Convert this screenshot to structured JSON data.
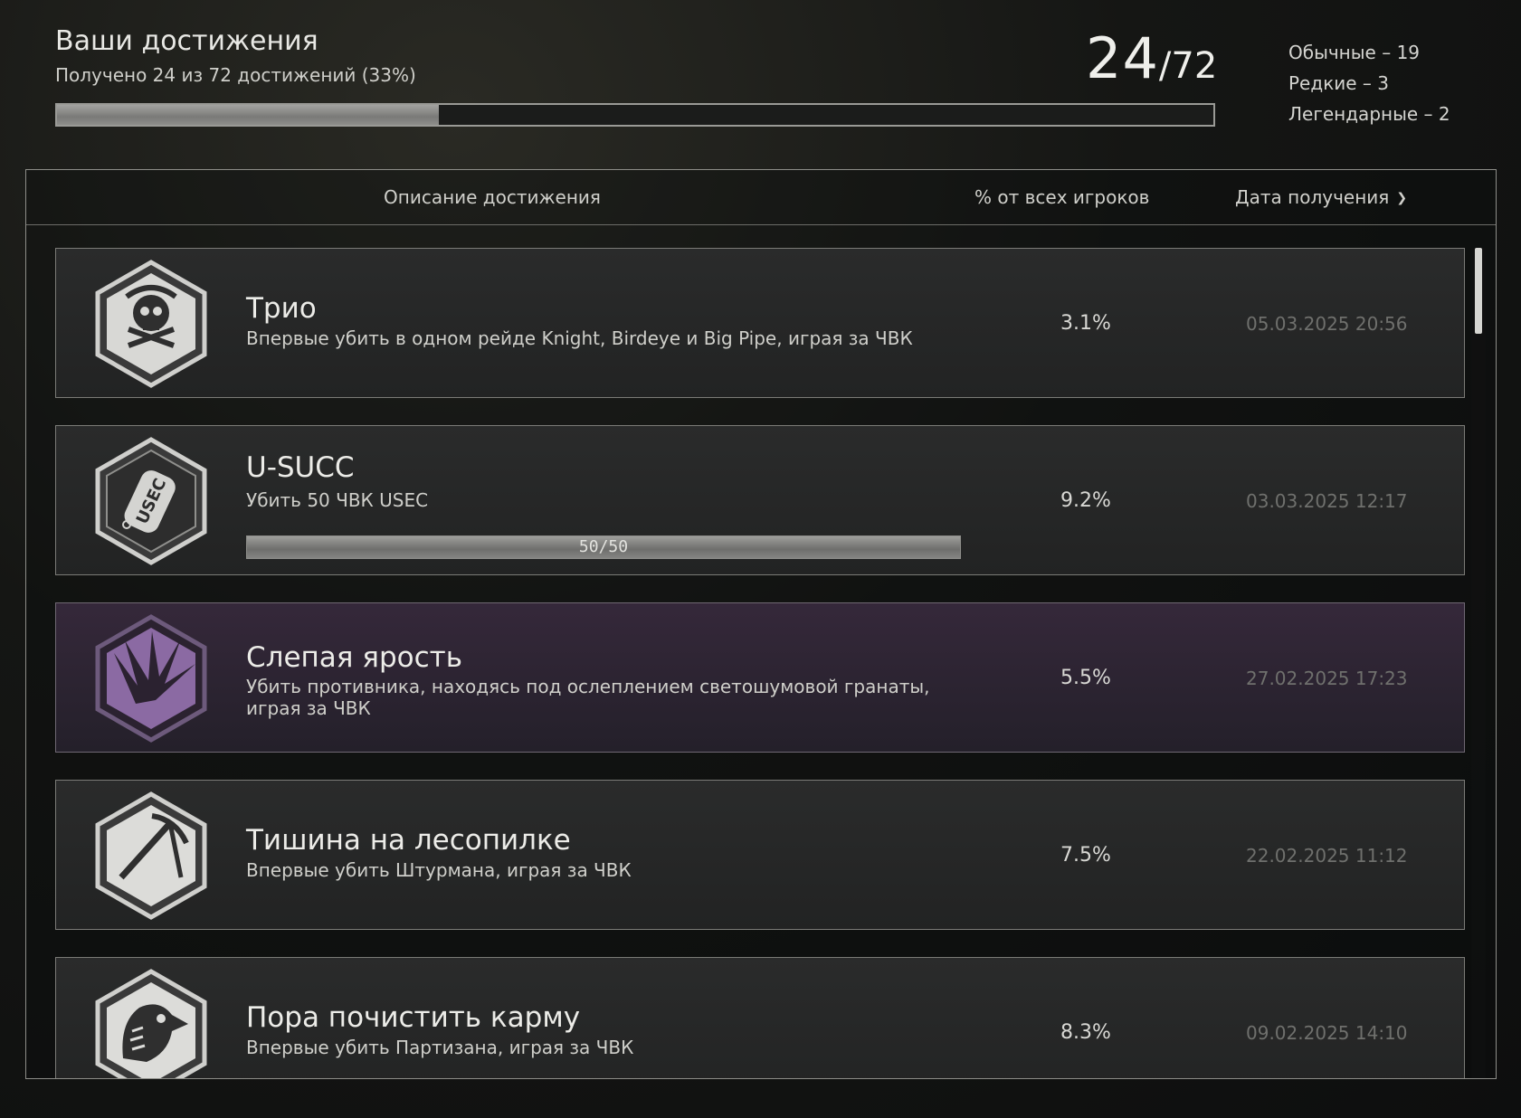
{
  "header": {
    "title": "Ваши достижения",
    "subtitle": "Получено 24 из 72 достижений (33%)",
    "progress_fraction": 0.33,
    "count_received": "24",
    "count_total": "/72",
    "rarity": [
      "Обычные – 19",
      "Редкие – 3",
      "Легендарные – 2"
    ]
  },
  "table": {
    "columns": {
      "description": "Описание достижения",
      "percent": "% от всех игроков",
      "date": "Дата получения"
    },
    "achievements": [
      {
        "title": "Трио",
        "description": "Впервые убить в одном рейде Knight, Birdeye и Big Pipe, играя за ЧВК",
        "percent": "3.1%",
        "date": "05.03.2025 20:56",
        "icon": "skull-pipe-icon",
        "rarity": "common"
      },
      {
        "title": "U-SUCC",
        "description": "Убить 50 ЧВК USEC",
        "percent": "9.2%",
        "date": "03.03.2025 12:17",
        "icon": "usec-dogtag-icon",
        "rarity": "common",
        "progress_label": "50/50",
        "progress_fraction": 1.0
      },
      {
        "title": "Слепая ярость",
        "description": "Убить противника, находясь под ослеплением светошумовой гранаты, играя за ЧВК",
        "percent": "5.5%",
        "date": "27.02.2025 17:23",
        "icon": "flash-burst-icon",
        "rarity": "legendary"
      },
      {
        "title": "Тишина на лесопилке",
        "description": "Впервые убить Штурмана, играя за ЧВК",
        "percent": "7.5%",
        "date": "22.02.2025 11:12",
        "icon": "ice-axe-icon",
        "rarity": "common"
      },
      {
        "title": "Пора почистить карму",
        "description": "Впервые убить Партизана, играя за ЧВК",
        "percent": "8.3%",
        "date": "09.02.2025 14:10",
        "icon": "bird-head-icon",
        "rarity": "common"
      }
    ]
  },
  "colors": {
    "legendary_bg": "#35283a",
    "legendary_badge": "#8b6aa3",
    "common_badge": "#d9d9d6"
  }
}
